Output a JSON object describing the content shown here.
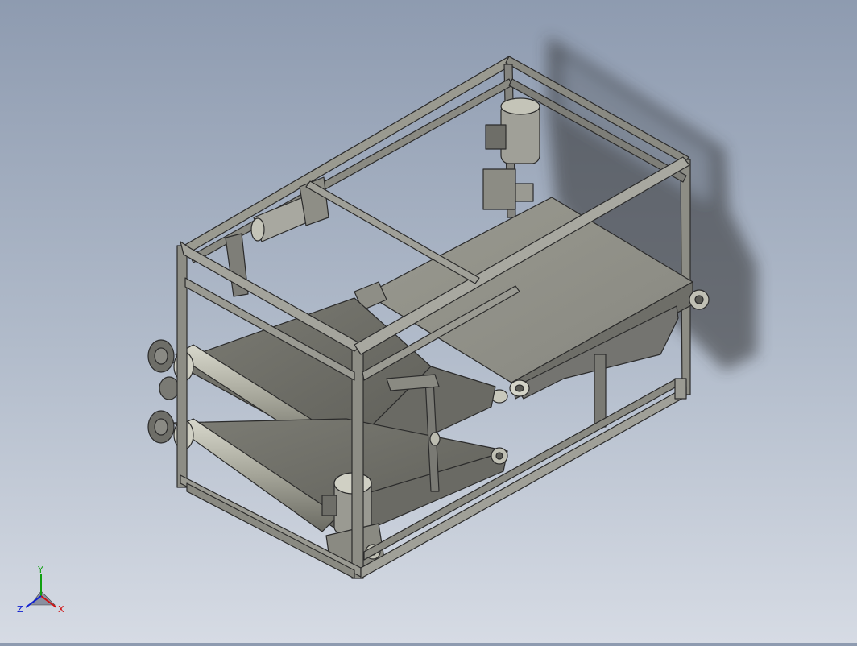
{
  "viewport": {
    "background_top": "#8e9bb0",
    "background_bottom": "#d6dbe4",
    "model_color": "#8c8c84",
    "edge_color": "#2b2b2b"
  },
  "triad": {
    "x_label": "X",
    "y_label": "Y",
    "z_label": "Z",
    "x_color": "#d01010",
    "y_color": "#10a010",
    "z_color": "#1020d0"
  }
}
